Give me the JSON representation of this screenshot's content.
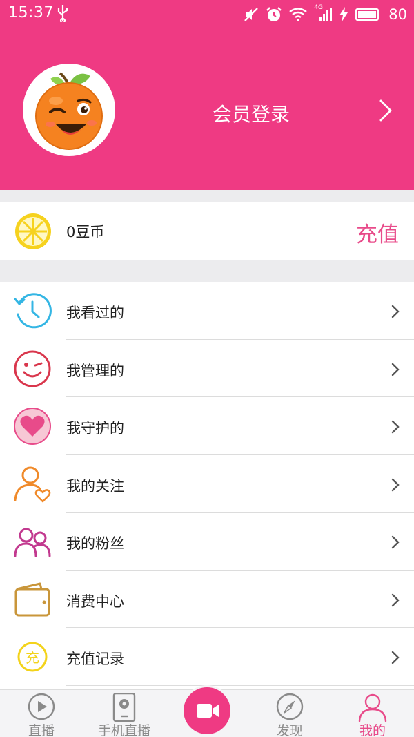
{
  "status": {
    "time": "15:37",
    "battery": "80",
    "network": "4G"
  },
  "colors": {
    "brand": "#ef3a83",
    "accent": "#e84b8a",
    "coin": "#f6d21e"
  },
  "profile": {
    "login_label": "会员登录",
    "avatar_icon": "orange-mascot-icon"
  },
  "wallet": {
    "balance_label": "0豆币",
    "recharge_label": "充值"
  },
  "menu": [
    {
      "label": "我看过的",
      "icon": "history-clock-icon"
    },
    {
      "label": "我管理的",
      "icon": "wink-face-icon"
    },
    {
      "label": "我守护的",
      "icon": "heart-icon"
    },
    {
      "label": "我的关注",
      "icon": "follow-user-icon"
    },
    {
      "label": "我的粉丝",
      "icon": "fans-users-icon"
    },
    {
      "label": "消费中心",
      "icon": "wallet-icon"
    },
    {
      "label": "充值记录",
      "icon": "recharge-icon",
      "icon_text": "充"
    }
  ],
  "tabs": [
    {
      "label": "直播",
      "icon": "play-circle-icon"
    },
    {
      "label": "手机直播",
      "icon": "phone-live-icon"
    },
    {
      "label": "",
      "icon": "video-camera-icon"
    },
    {
      "label": "发现",
      "icon": "compass-icon"
    },
    {
      "label": "我的",
      "icon": "user-icon",
      "active": true
    }
  ]
}
